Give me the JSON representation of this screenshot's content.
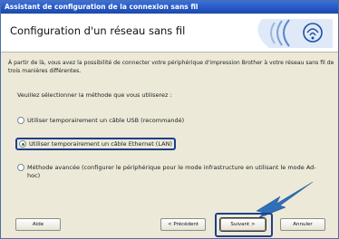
{
  "window": {
    "title": "Assistant de configuration de la connexion sans fil"
  },
  "header": {
    "title": "Configuration d'un réseau sans fil"
  },
  "intro": "À partir de là, vous avez la possibilité de connecter votre périphérique d'impression Brother à votre réseau sans fil de trois manières différentes.",
  "question": "Veuillez sélectionner la méthode que vous utiliserez :",
  "options": [
    {
      "label": "Utiliser temporairement un câble USB (recommandé)",
      "selected": false
    },
    {
      "label": "Utiliser temporairement un câble Ethernet (LAN)",
      "selected": true
    },
    {
      "label": "Méthode avancée (configurer le périphérique pour le mode infrastructure en utilisant le mode Ad-hoc)",
      "selected": false
    }
  ],
  "buttons": {
    "help": "Aide",
    "back": "< Précédent",
    "next": "Suivant >",
    "cancel": "Annuler"
  },
  "icons": {
    "logo": "wifi-waves-icon",
    "pointer": "blue-arrow-pointer-icon"
  },
  "colors": {
    "titlebar": "#2356c4",
    "arrow": "#2f6fb8",
    "focus_ring": "#1e3f8a"
  }
}
